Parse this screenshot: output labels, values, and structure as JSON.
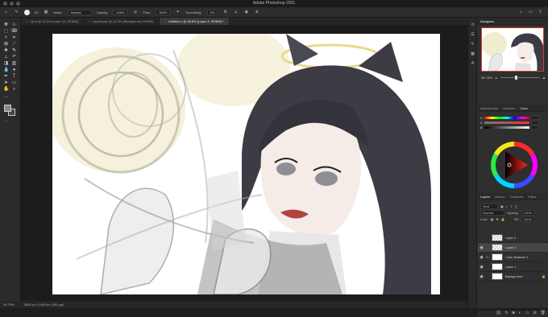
{
  "app_title": "Adobe Photoshop 2021",
  "options_bar": {
    "brush_size": "60",
    "mode_label": "Mode:",
    "mode_value": "Normal",
    "opacity_label": "Opacity:",
    "opacity_value": "100%",
    "flow_label": "Flow:",
    "flow_value": "100%",
    "smoothing_label": "Smoothing:",
    "smoothing_value": "0%"
  },
  "tabs": [
    {
      "label": "Lynd @ 12.5% (Layer 15, RGB/8)",
      "active": false
    },
    {
      "label": "layout.psd @ 12.5% (Background, RGB/8)",
      "active": false
    },
    {
      "label": "Untitled-1 @ 36.8% (Layer 3, RGB/8) *",
      "active": true
    }
  ],
  "status": {
    "zoom": "36.79%",
    "doc_info": "3508 px x 2480 px (300 ppi)"
  },
  "navigator": {
    "tab": "Navigator",
    "zoom": "36.79%"
  },
  "color_panel": {
    "tabs": [
      "Adjustments",
      "Libraries",
      "Color"
    ],
    "active_tab": "Color"
  },
  "layers_panel": {
    "tabs": [
      "Layers",
      "History",
      "Channels",
      "Paths"
    ],
    "active_tab": "Layers",
    "filter": "Kind",
    "blend_mode": "Normal",
    "opacity_label": "Opacity:",
    "opacity_value": "100%",
    "lock_label": "Lock:",
    "fill_label": "Fill:",
    "fill_value": "100%",
    "layers": [
      {
        "name": "Layer 2",
        "visible": false,
        "selected": false,
        "thumb": "checker"
      },
      {
        "name": "Layer 3",
        "visible": true,
        "selected": true,
        "thumb": "checker"
      },
      {
        "name": "Color Balance 1",
        "visible": true,
        "selected": false,
        "thumb": "white"
      },
      {
        "name": "Layer 1",
        "visible": true,
        "selected": false,
        "thumb": "white"
      },
      {
        "name": "Background",
        "visible": true,
        "selected": false,
        "thumb": "white"
      }
    ]
  },
  "colors": {
    "accent_border": "#d23b3b",
    "foreground": "#8a8a8a",
    "background": "#444444"
  }
}
